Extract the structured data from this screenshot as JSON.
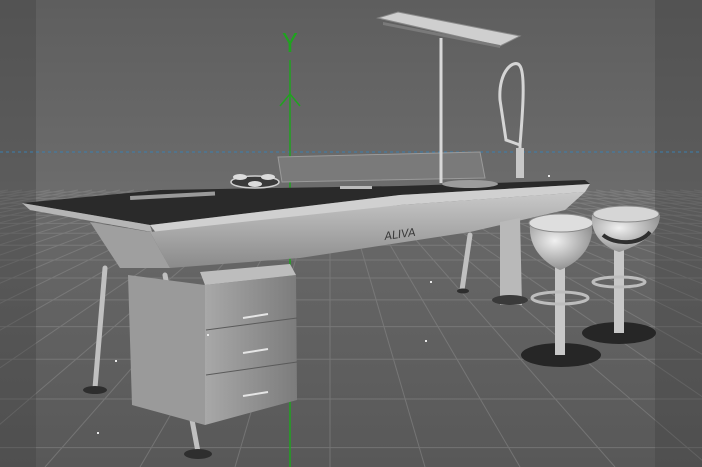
{
  "viewport": {
    "axis_label": "Y",
    "axis_color": "#1fa31f",
    "horizon_color": "#3b7fae",
    "background": "#5a5a5a",
    "safe_frame_shade": "#4a4a4a"
  },
  "scene": {
    "island_logo": "ALIVA",
    "objects": [
      "kitchen-island",
      "pendant-lamp",
      "pull-down-faucet",
      "cooktop",
      "drawer-cabinet",
      "bar-stool",
      "bar-stool"
    ]
  }
}
